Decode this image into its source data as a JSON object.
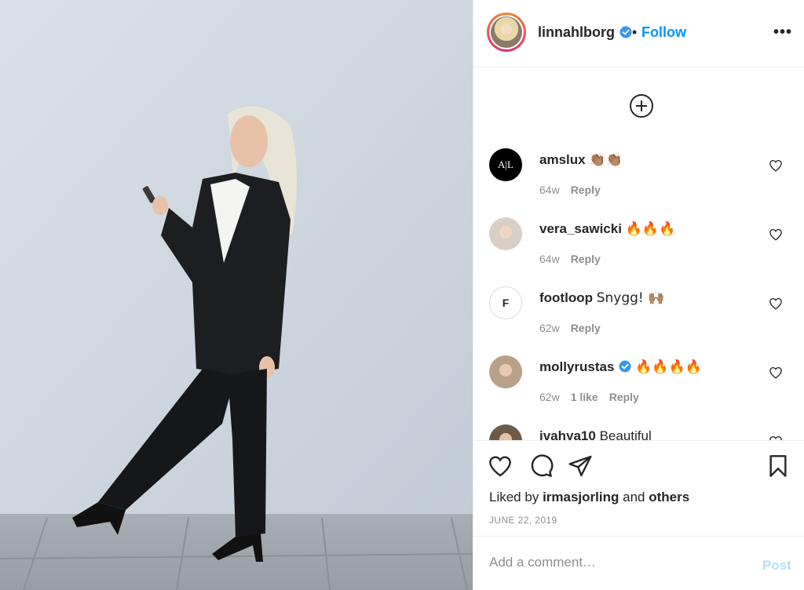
{
  "post": {
    "username": "linnahlborg",
    "separator": "•",
    "follow_label": "Follow",
    "more_label": "•••",
    "date": "JUNE 22, 2019"
  },
  "photo": {
    "alt": "Woman in black suit posing against white wall"
  },
  "comments": [
    {
      "username": "amslux",
      "text": "👏🏽👏🏽",
      "age": "64w",
      "reply": "Reply",
      "avatar_text": "A|L",
      "verified": false
    },
    {
      "username": "vera_sawicki",
      "text": "🔥🔥🔥",
      "age": "64w",
      "reply": "Reply",
      "verified": false
    },
    {
      "username": "footloop",
      "text": "Snygg! 🙌🏽",
      "age": "62w",
      "reply": "Reply",
      "avatar_text": "F",
      "verified": false
    },
    {
      "username": "mollyrustas",
      "text": "🔥🔥🔥🔥",
      "age": "62w",
      "likes": "1 like",
      "reply": "Reply",
      "verified": true
    },
    {
      "username": "ivahya10",
      "text": "Beautiful",
      "verified": false
    }
  ],
  "likes": {
    "prefix": "Liked by",
    "user": "irmasjorling",
    "connector": "and",
    "others": "others"
  },
  "add_comment": {
    "placeholder": "Add a comment…",
    "post_label": "Post"
  },
  "colors": {
    "accent": "#0095f6",
    "post_disabled": "#b2dffc",
    "meta": "#8e8e8e"
  }
}
